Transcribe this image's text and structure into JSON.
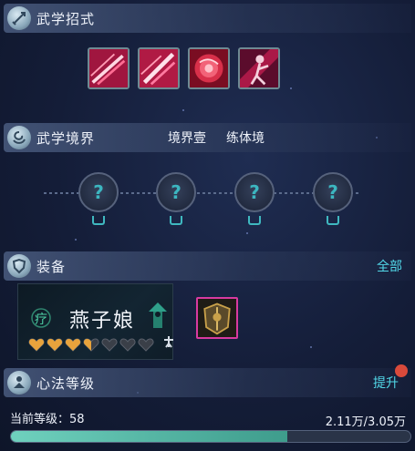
{
  "skills_section": {
    "title": "武学招式",
    "skills": [
      {
        "name": "skill-slash-1",
        "accent": "#e0245a"
      },
      {
        "name": "skill-slash-2",
        "accent": "#e0245a"
      },
      {
        "name": "skill-rose",
        "accent": "#d8304a"
      },
      {
        "name": "skill-figure",
        "accent": "#c01b58"
      }
    ]
  },
  "realm_section": {
    "title": "武学境界",
    "realm_name": "境界壹",
    "realm_stage": "练体境",
    "nodes": [
      "?",
      "?",
      "?",
      "?"
    ]
  },
  "equip_section": {
    "title": "装备",
    "action": "全部",
    "card": {
      "emblem_char": "疗",
      "name": "燕子娘",
      "hearts_filled": 3.5,
      "hearts_total": 7
    }
  },
  "level_section": {
    "title": "心法等级",
    "action": "提升",
    "level_text": "当前等级：58",
    "exp_text": "2.11万/3.05万",
    "progress_fraction": 0.6918
  },
  "colors": {
    "accent_cyan": "#52d8e8",
    "progress_fill": "#4fb7a4",
    "heart_gold": "#e8a33c",
    "badge_red": "#d94a3b"
  }
}
